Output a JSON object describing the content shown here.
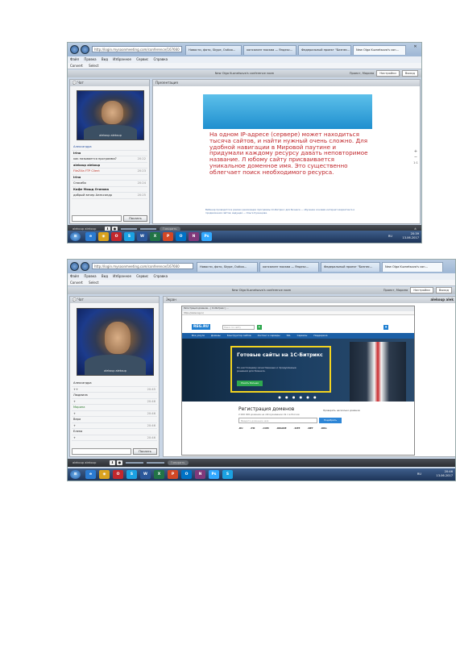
{
  "colors": {
    "browser_chrome": "#b9cce2",
    "slide_text": "#c0262b",
    "taskbar": "#1d3458",
    "reg_nav": "#1b5fa6",
    "reg_hero_border": "#f2d320",
    "reg_button_green": "#2fa84f"
  },
  "shot1": {
    "browser": {
      "url": "http://login.mysoonmeeting.com/conference/167660",
      "tabs": [
        "Новости, фото, Skype, Outloo...",
        "консалинг москва — Яндекс...",
        "Федеральный проект \"Бизнес...",
        "New Olga Kuznetsova's con..."
      ],
      "menu": [
        "Файл",
        "Правка",
        "Вид",
        "Избранное",
        "Сервис",
        "Справка"
      ],
      "commands": [
        "Convert",
        "Select"
      ]
    },
    "conference": {
      "title": "New Olga Kuznetsova's conference room",
      "right_label": "Проект, Марина",
      "settings_label": "Настройки",
      "exit_label": "Выход"
    },
    "chat": {
      "header": "Чат",
      "webcam_caption": "alekoup alekoup",
      "messages": [
        {
          "text": "Александра",
          "kind": "blue",
          "time": ""
        },
        {
          "text": "Irina",
          "kind": "nick",
          "time": ""
        },
        {
          "text": "как называется программа?",
          "kind": "",
          "time": "20:22"
        },
        {
          "text": "alekoup alekoup",
          "kind": "nick",
          "time": ""
        },
        {
          "text": "FileZilla FTP Client",
          "kind": "red",
          "time": "20:23"
        },
        {
          "text": "Irina",
          "kind": "nick",
          "time": ""
        },
        {
          "text": "Спасибо",
          "kind": "",
          "time": "20:24"
        },
        {
          "text": "Кафе Мишд Отинова",
          "kind": "nick",
          "time": ""
        },
        {
          "text": "добрый вечер Александр",
          "kind": "",
          "time": "20:25"
        }
      ],
      "send_label": "Послать"
    },
    "presentation": {
      "header": "Презентация",
      "slide_text": "На одном IP-адресе (сервере) может находиться тысяча сайтов, и найти нужный очень сложно. Для удобной навигации в Мировой паутине и придумали каждому ресурсу давать неповторимое название. Л юбому сайту присваивается уникальное доменное имя. Это существенно облегчает поиск необходимого ресурса.",
      "slide_footer": "Вебинар проводится в рамках реализации программы 1С-Битрикс для бизнеса — обучение основам интернет-маркетинга и продвижения сайтов; ведущая — Ольга Кузнецова.",
      "zoom_icons": [
        "+",
        "−",
        "1:1"
      ]
    },
    "controls": {
      "user_label": "alekoup alekoup",
      "talk_label": "Говорить"
    },
    "taskbar": {
      "apps": [
        "IE",
        "Chrome",
        "Opera",
        "Skype",
        "Word",
        "Excel",
        "PowerPoint",
        "Outlook",
        "OneNote",
        "Photoshop"
      ],
      "lang": "RU",
      "time": "20:39",
      "date": "13.06.2017"
    }
  },
  "shot2": {
    "browser": {
      "url": "http://login.mysoonmeeting.com/conference/167660",
      "tabs": [
        "Новости, фото, Skype, Outloo...",
        "консалинг москва — Яндекс...",
        "Федеральный проект \"Бизнес...",
        "New Olga Kuznetsova's con..."
      ],
      "menu": [
        "Файл",
        "Правка",
        "Вид",
        "Избранное",
        "Сервис",
        "Справка"
      ],
      "commands": [
        "Convert",
        "Select"
      ]
    },
    "conference": {
      "title": "New Olga Kuznetsova's conference room",
      "right_label": "Проект, Марина",
      "settings_label": "Настройки",
      "exit_label": "Выход"
    },
    "chat": {
      "header": "Чат",
      "header_right": "alekoup alek",
      "webcam_caption": "alekoup alekoup",
      "messages": [
        {
          "text": "Александра",
          "kind": "",
          "time": ""
        },
        {
          "text": "++",
          "kind": "",
          "time": "20:45"
        },
        {
          "text": "Людмила",
          "kind": "",
          "time": ""
        },
        {
          "text": "+",
          "kind": "",
          "time": "20:46"
        },
        {
          "text": "Марина",
          "kind": "green",
          "time": ""
        },
        {
          "text": "+",
          "kind": "",
          "time": "20:46"
        },
        {
          "text": "Вера",
          "kind": "",
          "time": ""
        },
        {
          "text": "+",
          "kind": "",
          "time": "20:46"
        },
        {
          "text": "Елена",
          "kind": "",
          "time": ""
        },
        {
          "text": "+",
          "kind": "",
          "time": "20:46"
        }
      ],
      "send_label": "Послать"
    },
    "screen": {
      "header": "Экран",
      "site": {
        "tabs_text": "Регистрация доменов... | 1С-Битрикс | ...",
        "url": "https://www.reg.ru/",
        "logo": "REG.RU",
        "search_placeholder": "Поиск по сайту",
        "nav": [
          "Все услуги",
          "Домены",
          "Конструктор сайтов",
          "Хостинг и серверы",
          "SSL",
          "Сервисы",
          "Поддержка"
        ],
        "hero_title": "Готовые сайты на 1С-Битрикс",
        "hero_sub": "По-настоящему качественные и продуманные решения для бизнеса.",
        "hero_button": "Узнать больше",
        "hero_dots": "● ● ● ● ● ●",
        "domain_title": "Регистрация доменов",
        "domain_sub": "2 000 000 доменов на обслуживании. № 1 в России",
        "domain_check": "Проверить несколько доменов",
        "domain_placeholder": "Введите доменное имя",
        "domain_button": "Подобрать",
        "zones": [
          ".RU",
          ".РФ",
          ".COM",
          ".ONLINE",
          ".SITE",
          ".NET",
          ".ORG"
        ]
      }
    },
    "controls": {
      "user_label": "alekoup alekoup",
      "talk_label": "Говорить"
    },
    "taskbar": {
      "apps": [
        "IE",
        "Chrome",
        "Opera",
        "Skype",
        "Word",
        "Excel",
        "PowerPoint",
        "Outlook",
        "OneNote",
        "Photoshop",
        "Skype"
      ],
      "lang": "RU",
      "time": "20:46",
      "date": "13.06.2017"
    }
  }
}
